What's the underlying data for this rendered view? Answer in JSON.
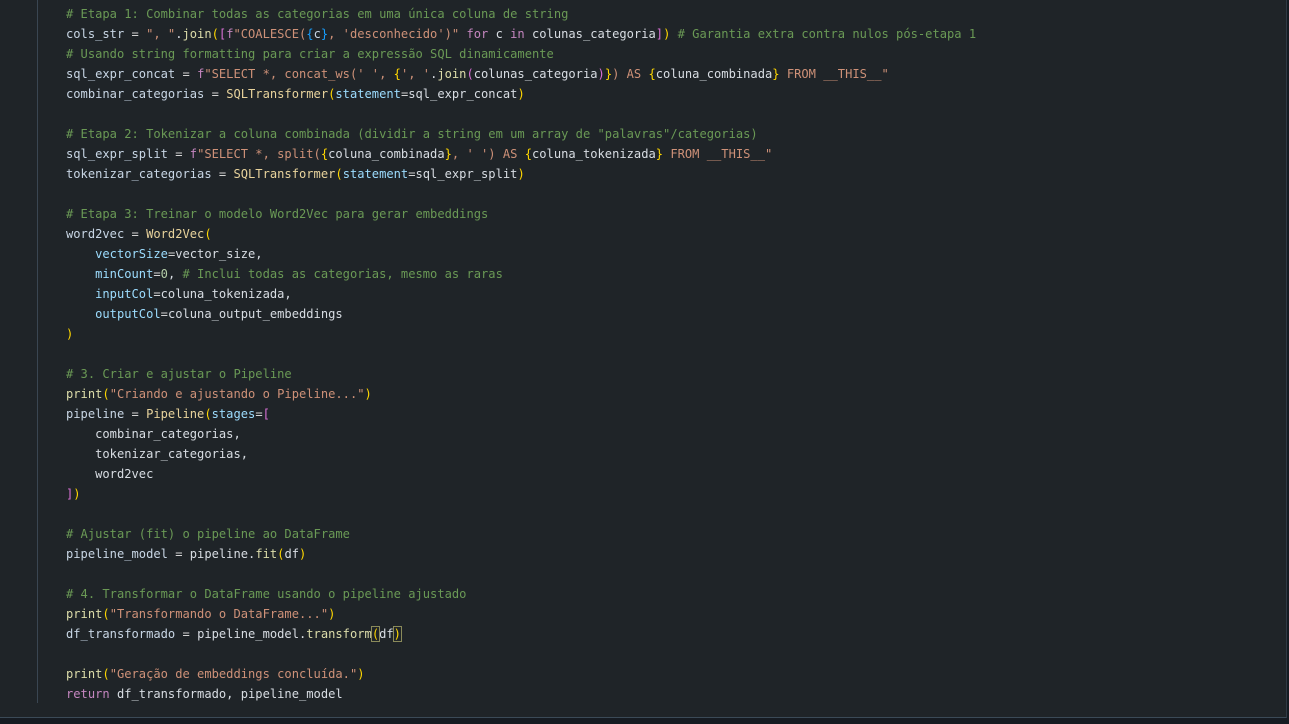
{
  "editor": {
    "language": "python",
    "lines": [
      [
        [
          "comment",
          "# Etapa 1: Combinar todas as categorias em uma única coluna de string"
        ]
      ],
      [
        [
          "var",
          "cols_str"
        ],
        [
          "op",
          " = "
        ],
        [
          "str",
          "\", \""
        ],
        [
          "plain",
          "."
        ],
        [
          "fn",
          "join"
        ],
        [
          "br1",
          "("
        ],
        [
          "br2",
          "["
        ],
        [
          "kw",
          "f"
        ],
        [
          "str",
          "\"COALESCE("
        ],
        [
          "br3",
          "{"
        ],
        [
          "var",
          "c"
        ],
        [
          "br3",
          "}"
        ],
        [
          "str",
          ", 'desconhecido')\""
        ],
        [
          "plain",
          " "
        ],
        [
          "kw",
          "for"
        ],
        [
          "plain",
          " c "
        ],
        [
          "kw",
          "in"
        ],
        [
          "plain",
          " colunas_categoria"
        ],
        [
          "br2",
          "]"
        ],
        [
          "br1",
          ")"
        ],
        [
          "plain",
          " "
        ],
        [
          "comment",
          "# Garantia extra contra nulos pós-etapa 1"
        ]
      ],
      [
        [
          "comment",
          "# Usando string formatting para criar a expressão SQL dinamicamente"
        ]
      ],
      [
        [
          "var",
          "sql_expr_concat"
        ],
        [
          "op",
          " = "
        ],
        [
          "kw",
          "f"
        ],
        [
          "str",
          "\"SELECT *, concat_ws(' ', "
        ],
        [
          "br1",
          "{"
        ],
        [
          "str",
          "', '"
        ],
        [
          "plain",
          "."
        ],
        [
          "fn",
          "join"
        ],
        [
          "br2",
          "("
        ],
        [
          "plain",
          "colunas_categoria"
        ],
        [
          "br2",
          ")"
        ],
        [
          "br1",
          "}"
        ],
        [
          "str",
          ") AS "
        ],
        [
          "br1",
          "{"
        ],
        [
          "plain",
          "coluna_combinada"
        ],
        [
          "br1",
          "}"
        ],
        [
          "str",
          " FROM __THIS__\""
        ]
      ],
      [
        [
          "var",
          "combinar_categorias"
        ],
        [
          "op",
          " = "
        ],
        [
          "cls",
          "SQLTransformer"
        ],
        [
          "br1",
          "("
        ],
        [
          "param",
          "statement"
        ],
        [
          "op",
          "="
        ],
        [
          "plain",
          "sql_expr_concat"
        ],
        [
          "br1",
          ")"
        ]
      ],
      [],
      [
        [
          "comment",
          "# Etapa 2: Tokenizar a coluna combinada (dividir a string em um array de \"palavras\"/categorias)"
        ]
      ],
      [
        [
          "var",
          "sql_expr_split"
        ],
        [
          "op",
          " = "
        ],
        [
          "kw",
          "f"
        ],
        [
          "str",
          "\"SELECT *, split("
        ],
        [
          "br1",
          "{"
        ],
        [
          "plain",
          "coluna_combinada"
        ],
        [
          "br1",
          "}"
        ],
        [
          "str",
          ", ' ') AS "
        ],
        [
          "br1",
          "{"
        ],
        [
          "plain",
          "coluna_tokenizada"
        ],
        [
          "br1",
          "}"
        ],
        [
          "str",
          " FROM __THIS__\""
        ]
      ],
      [
        [
          "var",
          "tokenizar_categorias"
        ],
        [
          "op",
          " = "
        ],
        [
          "cls",
          "SQLTransformer"
        ],
        [
          "br1",
          "("
        ],
        [
          "param",
          "statement"
        ],
        [
          "op",
          "="
        ],
        [
          "plain",
          "sql_expr_split"
        ],
        [
          "br1",
          ")"
        ]
      ],
      [],
      [
        [
          "comment",
          "# Etapa 3: Treinar o modelo Word2Vec para gerar embeddings"
        ]
      ],
      [
        [
          "var",
          "word2vec"
        ],
        [
          "op",
          " = "
        ],
        [
          "cls",
          "Word2Vec"
        ],
        [
          "br1",
          "("
        ]
      ],
      [
        [
          "plain",
          "    "
        ],
        [
          "param",
          "vectorSize"
        ],
        [
          "op",
          "="
        ],
        [
          "plain",
          "vector_size,"
        ]
      ],
      [
        [
          "plain",
          "    "
        ],
        [
          "param",
          "minCount"
        ],
        [
          "op",
          "="
        ],
        [
          "num",
          "0"
        ],
        [
          "plain",
          ", "
        ],
        [
          "comment",
          "# Inclui todas as categorias, mesmo as raras"
        ]
      ],
      [
        [
          "plain",
          "    "
        ],
        [
          "param",
          "inputCol"
        ],
        [
          "op",
          "="
        ],
        [
          "plain",
          "coluna_tokenizada,"
        ]
      ],
      [
        [
          "plain",
          "    "
        ],
        [
          "param",
          "outputCol"
        ],
        [
          "op",
          "="
        ],
        [
          "plain",
          "coluna_output_embeddings"
        ]
      ],
      [
        [
          "br1",
          ")"
        ]
      ],
      [],
      [
        [
          "comment",
          "# 3. Criar e ajustar o Pipeline"
        ]
      ],
      [
        [
          "fn",
          "print"
        ],
        [
          "br1",
          "("
        ],
        [
          "str",
          "\"Criando e ajustando o Pipeline...\""
        ],
        [
          "br1",
          ")"
        ]
      ],
      [
        [
          "var",
          "pipeline"
        ],
        [
          "op",
          " = "
        ],
        [
          "cls",
          "Pipeline"
        ],
        [
          "br1",
          "("
        ],
        [
          "param",
          "stages"
        ],
        [
          "op",
          "="
        ],
        [
          "br2",
          "["
        ]
      ],
      [
        [
          "plain",
          "    combinar_categorias,"
        ]
      ],
      [
        [
          "plain",
          "    tokenizar_categorias,"
        ]
      ],
      [
        [
          "plain",
          "    word2vec"
        ]
      ],
      [
        [
          "br2",
          "]"
        ],
        [
          "br1",
          ")"
        ]
      ],
      [],
      [
        [
          "comment",
          "# Ajustar (fit) o pipeline ao DataFrame"
        ]
      ],
      [
        [
          "var",
          "pipeline_model"
        ],
        [
          "op",
          " = "
        ],
        [
          "plain",
          "pipeline."
        ],
        [
          "fn",
          "fit"
        ],
        [
          "br1",
          "("
        ],
        [
          "plain",
          "df"
        ],
        [
          "br1",
          ")"
        ]
      ],
      [],
      [
        [
          "comment",
          "# 4. Transformar o DataFrame usando o pipeline ajustado"
        ]
      ],
      [
        [
          "fn",
          "print"
        ],
        [
          "br1",
          "("
        ],
        [
          "str",
          "\"Transformando o DataFrame...\""
        ],
        [
          "br1",
          ")"
        ]
      ],
      [
        [
          "var",
          "df_transformado"
        ],
        [
          "op",
          " = "
        ],
        [
          "plain",
          "pipeline_model."
        ],
        [
          "fn",
          "transform"
        ],
        [
          "match",
          "("
        ],
        [
          "plain",
          "df"
        ],
        [
          "match",
          ")"
        ]
      ],
      [],
      [
        [
          "fn",
          "print"
        ],
        [
          "br1",
          "("
        ],
        [
          "str",
          "\"Geração de embeddings concluída.\""
        ],
        [
          "br1",
          ")"
        ]
      ],
      [
        [
          "kw",
          "return"
        ],
        [
          "plain",
          " df_transformado, pipeline_model"
        ]
      ]
    ]
  }
}
